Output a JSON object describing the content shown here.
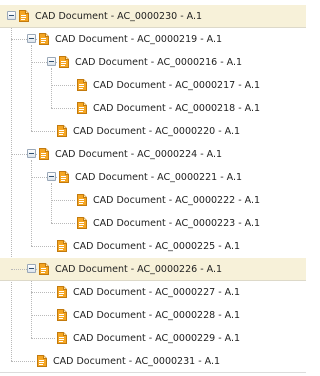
{
  "tree": {
    "items": [
      {
        "label": "CAD Document - AC_0000230 - A.1",
        "depth": 0,
        "expanded": true,
        "selected": true
      },
      {
        "label": "CAD Document - AC_0000219 - A.1",
        "depth": 1,
        "expanded": true,
        "selected": false
      },
      {
        "label": "CAD Document - AC_0000216 - A.1",
        "depth": 2,
        "expanded": true,
        "selected": false
      },
      {
        "label": "CAD Document - AC_0000217 - A.1",
        "depth": 3,
        "expanded": null,
        "selected": false
      },
      {
        "label": "CAD Document - AC_0000218 - A.1",
        "depth": 3,
        "expanded": null,
        "selected": false
      },
      {
        "label": "CAD Document - AC_0000220 - A.1",
        "depth": 2,
        "expanded": null,
        "selected": false
      },
      {
        "label": "CAD Document - AC_0000224 - A.1",
        "depth": 1,
        "expanded": true,
        "selected": false
      },
      {
        "label": "CAD Document - AC_0000221 - A.1",
        "depth": 2,
        "expanded": true,
        "selected": false
      },
      {
        "label": "CAD Document - AC_0000222 - A.1",
        "depth": 3,
        "expanded": null,
        "selected": false
      },
      {
        "label": "CAD Document - AC_0000223 - A.1",
        "depth": 3,
        "expanded": null,
        "selected": false
      },
      {
        "label": "CAD Document - AC_0000225 - A.1",
        "depth": 2,
        "expanded": null,
        "selected": false
      },
      {
        "label": "CAD Document - AC_0000226 - A.1",
        "depth": 1,
        "expanded": true,
        "selected": true
      },
      {
        "label": "CAD Document - AC_0000227 - A.1",
        "depth": 2,
        "expanded": null,
        "selected": false
      },
      {
        "label": "CAD Document - AC_0000228 - A.1",
        "depth": 2,
        "expanded": null,
        "selected": false
      },
      {
        "label": "CAD Document - AC_0000229 - A.1",
        "depth": 2,
        "expanded": null,
        "selected": false
      },
      {
        "label": "CAD Document - AC_0000231 - A.1",
        "depth": 1,
        "expanded": null,
        "selected": false
      }
    ]
  },
  "colors": {
    "selected_row": "#f7f1d9",
    "doc_icon_body": "#f5a623",
    "doc_icon_fold": "#fde7b0",
    "connector": "#b9b9b9"
  },
  "icons": {
    "toggle": "collapse-toggle-icon",
    "document": "cad-document-icon"
  }
}
